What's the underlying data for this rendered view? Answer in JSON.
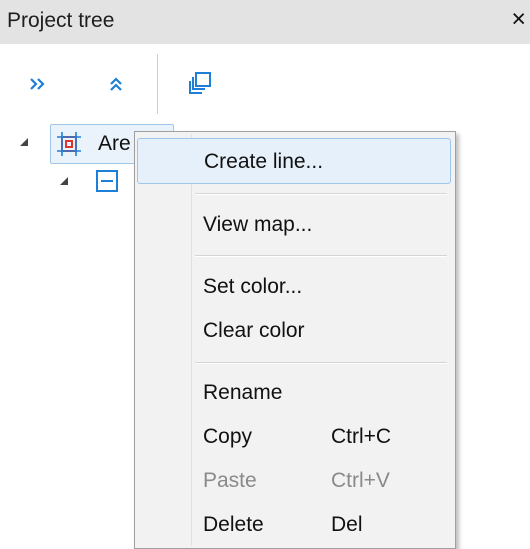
{
  "panel": {
    "title": "Project tree",
    "close_glyph": "×"
  },
  "toolbar": {
    "buttons": [
      {
        "icon": "expand-all-icon",
        "glyph": "»"
      },
      {
        "icon": "collapse-all-icon",
        "glyph": "»"
      },
      {
        "icon": "copy-windows-icon"
      }
    ]
  },
  "tree": {
    "root": {
      "label": "Are",
      "icon": "area-icon"
    },
    "child": {
      "icon": "line-item-icon"
    }
  },
  "context_menu": {
    "items": [
      {
        "label": "Create line...",
        "shortcut": "",
        "enabled": true,
        "highlighted": true
      },
      {
        "label": "View map...",
        "shortcut": "",
        "enabled": true
      },
      {
        "label": "Set color...",
        "shortcut": "",
        "enabled": true
      },
      {
        "label": "Clear color",
        "shortcut": "",
        "enabled": true
      },
      {
        "label": "Rename",
        "shortcut": "",
        "enabled": true
      },
      {
        "label": "Copy",
        "shortcut": "Ctrl+C",
        "enabled": true
      },
      {
        "label": "Paste",
        "shortcut": "Ctrl+V",
        "enabled": false
      },
      {
        "label": "Delete",
        "shortcut": "Del",
        "enabled": true
      }
    ]
  },
  "colors": {
    "accent": "#1e7fd6",
    "area_icon": "#e0332b",
    "highlight": "#e6f0fa"
  }
}
